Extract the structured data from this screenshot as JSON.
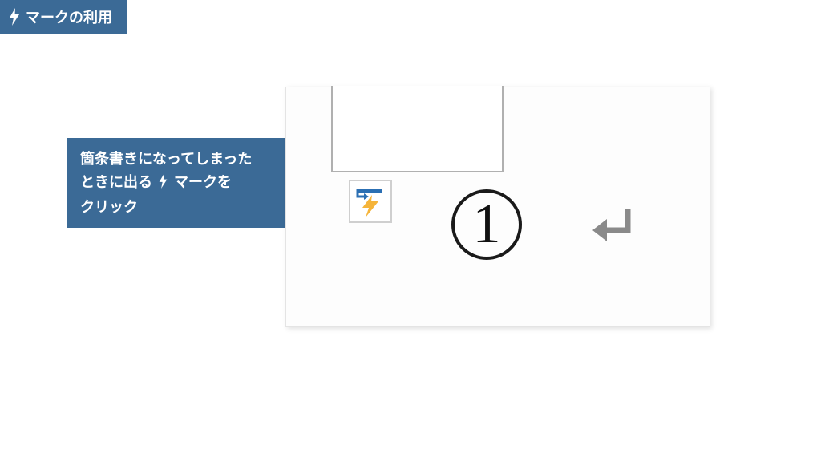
{
  "title": {
    "icon": "bolt-icon",
    "text": "マークの利用"
  },
  "callout": {
    "line1": "箇条書きになってしまった",
    "line2_prefix": "ときに出る",
    "line2_suffix": "マークを",
    "line3": "クリック",
    "icon": "bolt-icon"
  },
  "panel": {
    "autocorrect_icon": "autocorrect-options-icon",
    "list_marker": "1",
    "paragraph_icon": "paragraph-return-icon"
  }
}
